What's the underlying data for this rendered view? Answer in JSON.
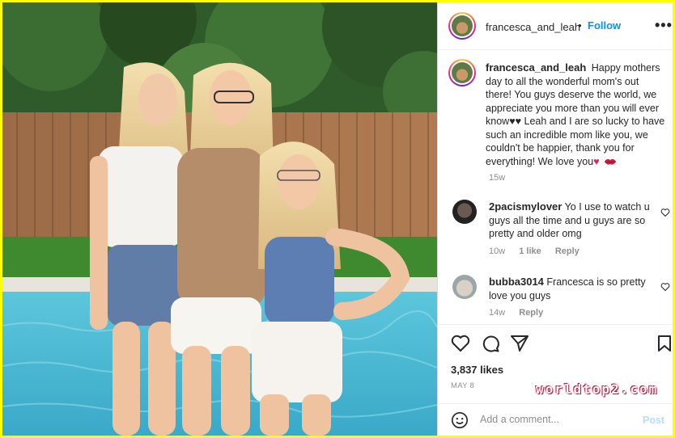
{
  "post": {
    "username": "francesca_and_leah",
    "follow_label": "Follow",
    "separator": "•",
    "more_label": "•••"
  },
  "caption": {
    "username": "francesca_and_leah",
    "text_part1": "Happy mothers day to all the wonderful mom's out there! You guys deserve the world, we appreciate you more than you will ever know",
    "hearts_black": "♥♥",
    "text_part2": " Leah and I are so lucky to have such an incredible mom like you, we couldn't be happier, thank you for everything! We love you",
    "hearts_red": "♥",
    "time": "15w"
  },
  "comments": [
    {
      "username": "2pacismylover",
      "text": "Yo I use to watch u guys all the time and u guys are so pretty and older omg",
      "time": "10w",
      "likes": "1 like",
      "reply": "Reply"
    },
    {
      "username": "bubba3014",
      "text": "Francesca is so pretty love you guys",
      "time": "14w",
      "reply": "Reply"
    }
  ],
  "actions": {
    "like_icon": "heart-icon",
    "comment_icon": "comment-icon",
    "share_icon": "share-icon",
    "save_icon": "bookmark-icon"
  },
  "likes": "3,837 likes",
  "date": "MAY 8",
  "watermark": "worldtop2.com",
  "add_comment": {
    "placeholder": "Add a comment...",
    "post_label": "Post"
  },
  "colors": {
    "follow": "#0095f6",
    "muted": "#8e8e8e",
    "post_disabled": "#b2dffc",
    "frame": "#ffff00"
  }
}
